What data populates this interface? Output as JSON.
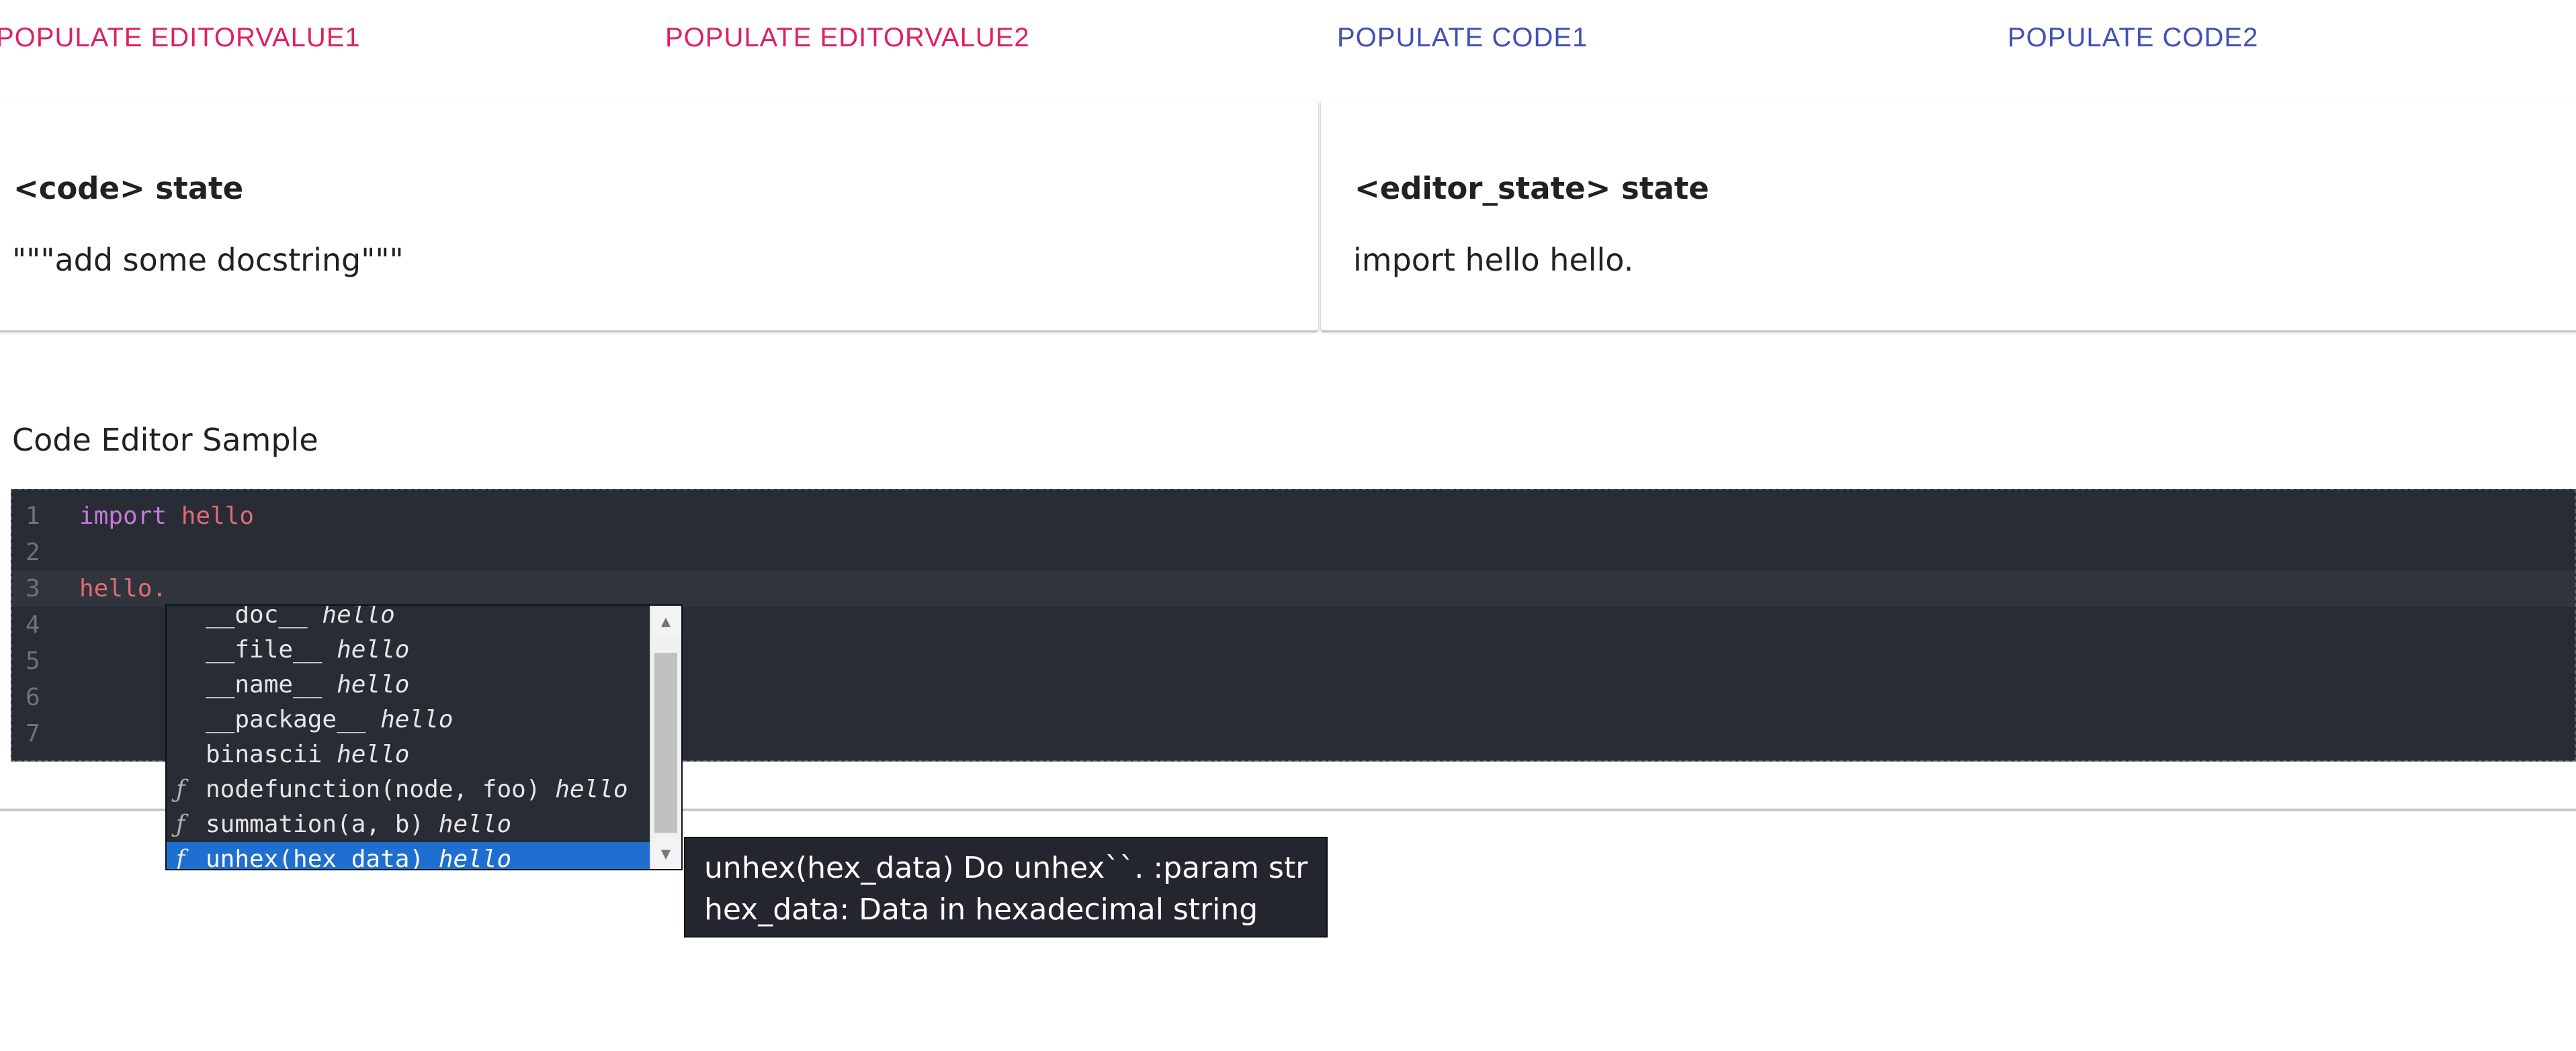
{
  "buttons": {
    "editor_value1": "POPULATE EDITORVALUE1",
    "editor_value2": "POPULATE EDITORVALUE2",
    "code1": "POPULATE CODE1",
    "code2": "POPULATE CODE2"
  },
  "cards": {
    "code": {
      "title": "<code> state",
      "value": "\"\"\"add some docstring\"\"\""
    },
    "editor_state": {
      "title": "<editor_state> state",
      "value": "import hello hello."
    }
  },
  "editor": {
    "title": "Code Editor Sample",
    "lines": [
      {
        "num": "1",
        "keyword": "import",
        "module": "hello",
        "rest": ""
      },
      {
        "num": "2",
        "keyword": "",
        "module": "",
        "rest": ""
      },
      {
        "num": "3",
        "keyword": "",
        "module": "hello.",
        "rest": ""
      },
      {
        "num": "4",
        "keyword": "",
        "module": "",
        "rest": ""
      },
      {
        "num": "5",
        "keyword": "",
        "module": "",
        "rest": ""
      },
      {
        "num": "6",
        "keyword": "",
        "module": "",
        "rest": ""
      },
      {
        "num": "7",
        "keyword": "",
        "module": "",
        "rest": ""
      }
    ]
  },
  "autocomplete": {
    "items": [
      {
        "icon": "",
        "label": "__doc__",
        "source": "hello"
      },
      {
        "icon": "",
        "label": "__file__",
        "source": "hello"
      },
      {
        "icon": "",
        "label": "__name__",
        "source": "hello"
      },
      {
        "icon": "",
        "label": "__package__",
        "source": "hello"
      },
      {
        "icon": "",
        "label": "binascii",
        "source": "hello"
      },
      {
        "icon": "ƒ",
        "label": "nodefunction(node, foo)",
        "source": "hello"
      },
      {
        "icon": "ƒ",
        "label": "summation(a, b)",
        "source": "hello"
      },
      {
        "icon": "ƒ",
        "label": "unhex(hex_data)",
        "source": "hello"
      }
    ],
    "selected_index": 7
  },
  "tooltip": {
    "line1": "unhex(hex_data) Do unhex``. :param str",
    "line2": "hex_data: Data in hexadecimal string"
  },
  "colors": {
    "pink_button": "#e0205f",
    "blue_button": "#3f51b5",
    "editor_bg": "#282c34",
    "selection": "#1f6fd1"
  }
}
